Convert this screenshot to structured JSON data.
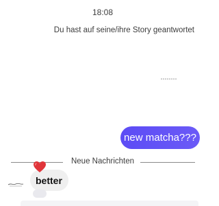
{
  "status_bar": {
    "time": "18:08"
  },
  "chat": {
    "story_reply_notice": "Du hast auf seine/ihre Story geantwortet",
    "outgoing_message": "new matcha???",
    "new_messages_divider": "Neue Nachrichten",
    "incoming_message": "better",
    "incoming_reaction": "heart-icon"
  },
  "colors": {
    "outgoing_bubble": "#6352f6",
    "incoming_bubble": "#efefef",
    "heart": "#e0353a"
  }
}
